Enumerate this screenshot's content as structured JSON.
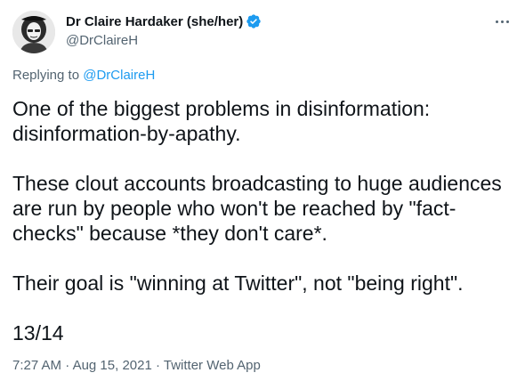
{
  "author": {
    "display_name": "Dr Claire Hardaker (she/her)",
    "handle": "@DrClaireH",
    "avatar_icon": "avatar-photo",
    "verified_icon": "verified-badge-icon",
    "verified_color": "#1d9bf0"
  },
  "more_icon": "more-options-icon",
  "reply_context": {
    "prefix": "Replying to ",
    "handle": "@DrClaireH"
  },
  "body": {
    "line1": "One of the biggest problems in disinformation: disinformation-by-apathy.",
    "line2": "These clout accounts broadcasting to huge audiences are run by people who won't be reached by \"fact-checks\" because *they don't care*.",
    "line3": "Their goal is \"winning at Twitter\", not \"being right\".",
    "line4": "13/14"
  },
  "meta": {
    "time": "7:27 AM",
    "sep1": " · ",
    "date": "Aug 15, 2021",
    "sep2": " · ",
    "source": "Twitter Web App"
  },
  "colors": {
    "text": "#0f1419",
    "secondary": "#536471",
    "link": "#1d9bf0"
  }
}
